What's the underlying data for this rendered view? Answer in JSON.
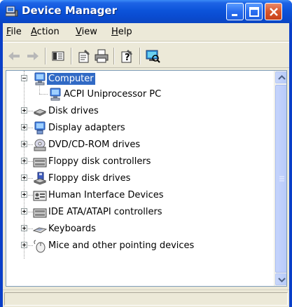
{
  "window": {
    "title": "Device Manager",
    "controls": [
      "minimize",
      "maximize",
      "close"
    ]
  },
  "menu": {
    "items": [
      {
        "label": "File",
        "accel": "F"
      },
      {
        "label": "Action",
        "accel": "A"
      },
      {
        "label": "View",
        "accel": "V"
      },
      {
        "label": "Help",
        "accel": "H"
      }
    ]
  },
  "toolbar": {
    "buttons": [
      "back-icon",
      "forward-icon",
      "show-hide-console-tree-icon",
      "properties-icon",
      "print-icon",
      "help-icon",
      "scan-hardware-icon"
    ]
  },
  "tree": {
    "items": [
      {
        "label": "Computer",
        "expander": "minus",
        "icon": "computer-icon",
        "selected": true
      },
      {
        "label": "ACPI Uniprocessor PC",
        "expander": "none",
        "icon": "computer-icon",
        "selected": false
      },
      {
        "label": "Disk drives",
        "expander": "plus",
        "icon": "disk-drive-icon",
        "selected": false
      },
      {
        "label": "Display adapters",
        "expander": "plus",
        "icon": "display-adapter-icon",
        "selected": false
      },
      {
        "label": "DVD/CD-ROM drives",
        "expander": "plus",
        "icon": "cdrom-icon",
        "selected": false
      },
      {
        "label": "Floppy disk controllers",
        "expander": "plus",
        "icon": "controller-icon",
        "selected": false
      },
      {
        "label": "Floppy disk drives",
        "expander": "plus",
        "icon": "floppy-drive-icon",
        "selected": false
      },
      {
        "label": "Human Interface Devices",
        "expander": "plus",
        "icon": "hid-icon",
        "selected": false
      },
      {
        "label": "IDE ATA/ATAPI controllers",
        "expander": "plus",
        "icon": "controller-icon",
        "selected": false
      },
      {
        "label": "Keyboards",
        "expander": "plus",
        "icon": "keyboard-icon",
        "selected": false
      },
      {
        "label": "Mice and other pointing devices",
        "expander": "plus",
        "icon": "mouse-icon",
        "selected": false
      }
    ]
  },
  "colors": {
    "title_bar": "#0a4cd2",
    "selection": "#316ac5",
    "window_face": "#ece9d8"
  }
}
